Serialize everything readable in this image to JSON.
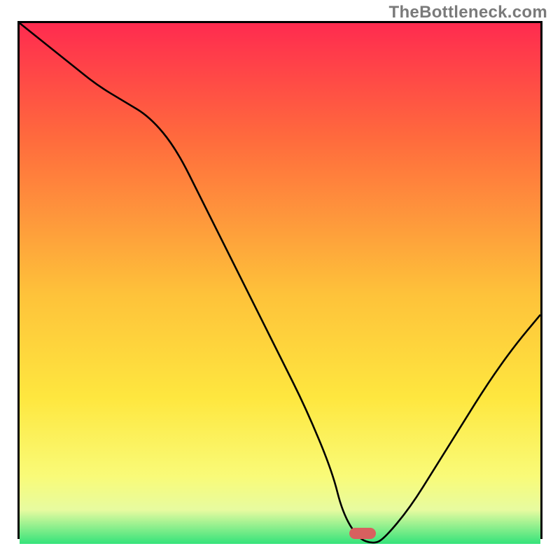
{
  "watermark": "TheBottleneck.com",
  "chart_data": {
    "type": "line",
    "title": "",
    "xlabel": "",
    "ylabel": "",
    "xlim": [
      0,
      100
    ],
    "ylim": [
      0,
      100
    ],
    "grid": false,
    "legend": false,
    "background_gradient_top_to_bottom": [
      "#ff2b4f",
      "#ff6a3d",
      "#fec23a",
      "#fee73f",
      "#f9fb78",
      "#e7fba0",
      "#34e37a"
    ],
    "series": [
      {
        "name": "bottleneck-curve",
        "color": "#000000",
        "x": [
          0,
          5,
          10,
          15,
          20,
          25,
          30,
          35,
          40,
          45,
          50,
          55,
          60,
          62,
          65,
          68,
          70,
          75,
          80,
          85,
          90,
          95,
          100
        ],
        "values": [
          100,
          96,
          92,
          88,
          85,
          82,
          76,
          66,
          56,
          46,
          36,
          26,
          14,
          6,
          1,
          0,
          1,
          7,
          15,
          23,
          31,
          38,
          44
        ]
      }
    ],
    "marker": {
      "name": "optimal-point",
      "x": 66,
      "y": 0.5,
      "color": "#d8605f",
      "shape": "rounded-bar"
    }
  }
}
